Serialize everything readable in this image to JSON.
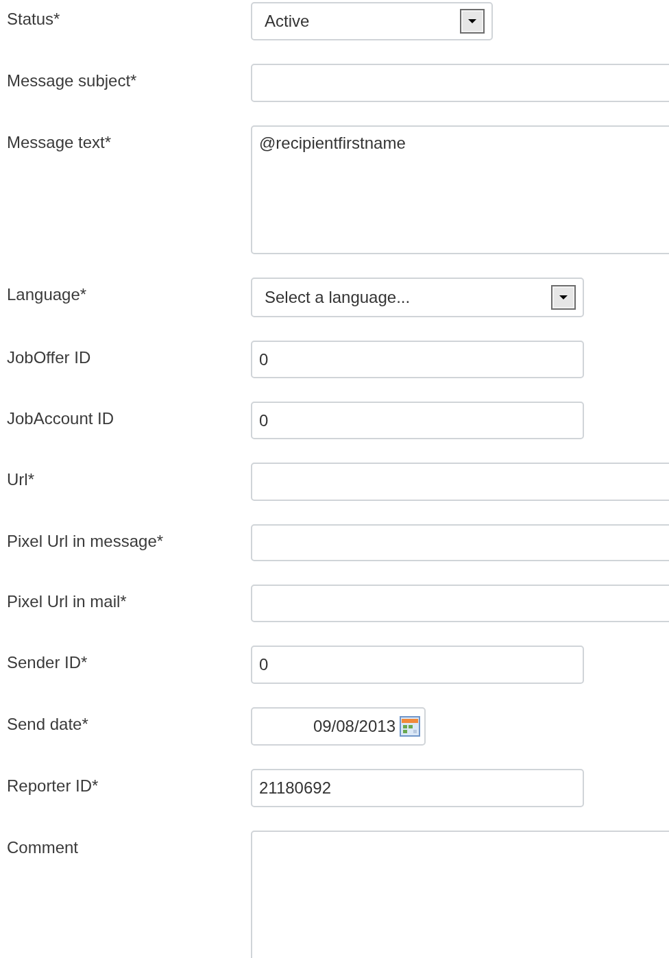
{
  "fields": [
    {
      "label": "Status*",
      "kind": "select",
      "value": "Active"
    },
    {
      "label": "Message subject*",
      "kind": "input"
    },
    {
      "label": "Message text*",
      "kind": "textarea",
      "value": "@recipientfirstname"
    },
    {
      "label": "Language*",
      "kind": "select",
      "value": "Select a language..."
    },
    {
      "label": "JobOffer ID",
      "kind": "input",
      "value": "0"
    },
    {
      "label": "JobAccount ID",
      "kind": "input",
      "value": "0"
    },
    {
      "label": "Url*",
      "kind": "input"
    },
    {
      "label": "Pixel Url in message*",
      "kind": "input"
    },
    {
      "label": "Pixel Url in mail*",
      "kind": "input"
    },
    {
      "label": "Sender ID*",
      "kind": "input",
      "value": "0"
    },
    {
      "label": "Send date*",
      "kind": "date",
      "value": "09/08/2013"
    },
    {
      "label": "Reporter ID*",
      "kind": "input",
      "value": "21180692"
    },
    {
      "label": "Comment",
      "kind": "textarea"
    }
  ]
}
